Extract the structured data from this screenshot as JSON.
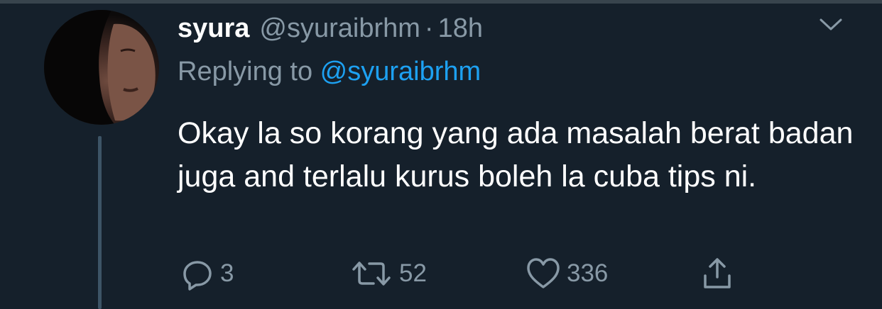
{
  "tweet": {
    "display_name": "syura",
    "handle": "@syuraibrhm",
    "separator": "·",
    "time": "18h",
    "replying_prefix": "Replying to ",
    "replying_handle": "@syuraibrhm",
    "text": "Okay la so korang yang ada masalah berat badan juga and terlalu kurus boleh la cuba tips ni."
  },
  "actions": {
    "reply_count": "3",
    "retweet_count": "52",
    "like_count": "336"
  },
  "icons": {
    "reply": "reply-icon",
    "retweet": "retweet-icon",
    "like": "heart-icon",
    "share": "share-icon",
    "menu": "chevron-down-icon"
  },
  "colors": {
    "background": "#15202b",
    "text_primary": "#ffffff",
    "text_secondary": "#8899a6",
    "link": "#1da1f2",
    "thread_line": "#3d5466"
  }
}
